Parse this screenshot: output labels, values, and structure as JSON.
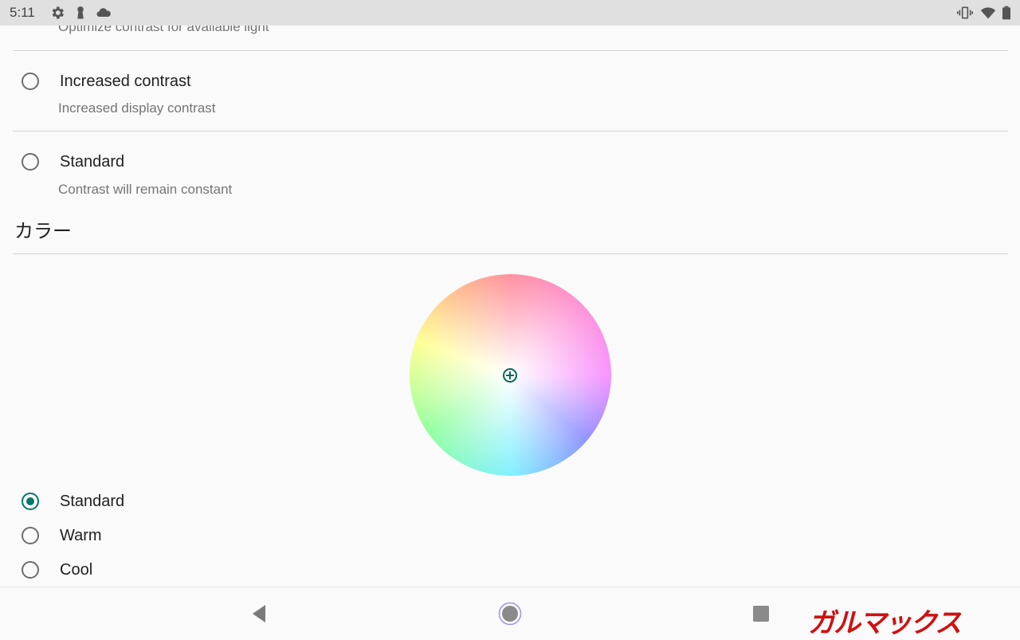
{
  "status_bar": {
    "time": "5:11",
    "icons_left": [
      "settings-icon",
      "keyhole-icon",
      "cloud-icon"
    ],
    "icons_right": [
      "vibrate-icon",
      "wifi-icon",
      "battery-icon"
    ]
  },
  "contrast": {
    "cut_off_subtitle": "Optimize contrast for available light",
    "options": [
      {
        "title": "Increased contrast",
        "subtitle": "Increased display contrast",
        "selected": false
      },
      {
        "title": "Standard",
        "subtitle": "Contrast will remain constant",
        "selected": false
      }
    ]
  },
  "color": {
    "section_title": "カラー",
    "wheel_icon": "color-wheel",
    "options": [
      {
        "label": "Standard",
        "selected": true
      },
      {
        "label": "Warm",
        "selected": false
      },
      {
        "label": "Cool",
        "selected": false
      }
    ],
    "accent": "#00796b"
  },
  "nav_bar": {
    "buttons": [
      "back-icon",
      "home-icon",
      "recents-icon"
    ]
  },
  "watermark": "ガルマックス"
}
